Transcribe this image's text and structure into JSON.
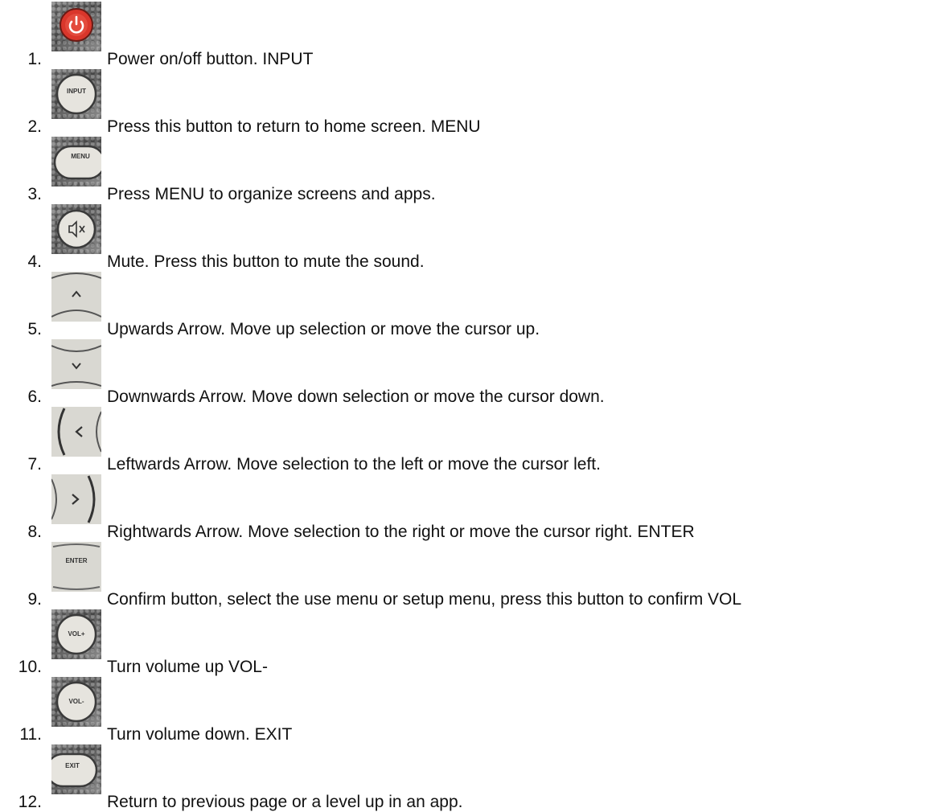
{
  "items": [
    {
      "number": "1.",
      "icon": "power-button-icon",
      "label": "",
      "text": "Power on/off button. INPUT"
    },
    {
      "number": "2.",
      "icon": "input-button-icon",
      "label": "INPUT",
      "text": "Press this button to return to home screen. MENU"
    },
    {
      "number": "3.",
      "icon": "menu-button-icon",
      "label": "MENU",
      "text": "Press MENU to organize screens and apps."
    },
    {
      "number": "4.",
      "icon": "mute-button-icon",
      "label": "",
      "text": "Mute. Press this button to mute the sound."
    },
    {
      "number": "5.",
      "icon": "up-arrow-button-icon",
      "label": "",
      "text": "Upwards Arrow. Move up selection or move the cursor up."
    },
    {
      "number": "6.",
      "icon": "down-arrow-button-icon",
      "label": "",
      "text": "Downwards Arrow. Move down selection or move the cursor down."
    },
    {
      "number": "7.",
      "icon": "left-arrow-button-icon",
      "label": "",
      "text": "Leftwards Arrow. Move selection to the left or move the cursor left."
    },
    {
      "number": "8.",
      "icon": "right-arrow-button-icon",
      "label": "",
      "text": "Rightwards Arrow. Move selection to the right or move the cursor right. ENTER"
    },
    {
      "number": "9.",
      "icon": "enter-button-icon",
      "label": "ENTER",
      "text": "Confirm button, select the use menu or setup menu, press this button to confirm VOL"
    },
    {
      "number": "10.",
      "icon": "volume-up-button-icon",
      "label": "VOL+",
      "text": "Turn volume up VOL-"
    },
    {
      "number": "11.",
      "icon": "volume-down-button-icon",
      "label": "VOL-",
      "text": "Turn volume down. EXIT"
    },
    {
      "number": "12.",
      "icon": "exit-button-icon",
      "label": "EXIT",
      "text": "Return to previous page or a level up in an app."
    }
  ],
  "colors": {
    "text": "#111111",
    "power": "#d9362b",
    "button_face": "#e6e4de",
    "button_edge": "#3a3a3a"
  }
}
